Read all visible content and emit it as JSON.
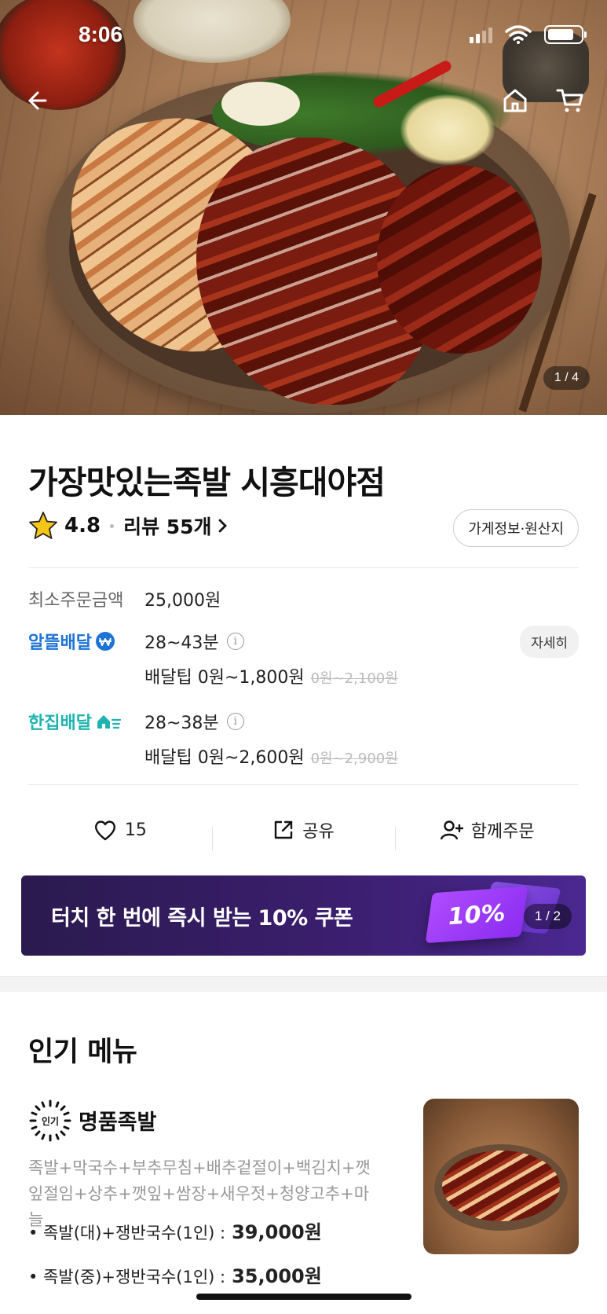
{
  "status_bar": {
    "time": "8:06"
  },
  "hero": {
    "photo_counter": "1 / 4"
  },
  "store": {
    "name": "가장맛있는족발 시흥대야점",
    "rating": "4.8",
    "review_label": "리뷰 55개",
    "info_button": "가게정보·원산지",
    "min_order_label": "최소주문금액",
    "min_order_value": "25,000원"
  },
  "delivery": [
    {
      "type": "알뜰배달",
      "color": "#1e73d6",
      "time": "28~43분",
      "tip": "배달팁 0원~1,800원",
      "original_tip": "0원~2,100원",
      "detail_button": "자세히"
    },
    {
      "type": "한집배달",
      "color": "#1fb3b0",
      "time": "28~38분",
      "tip": "배달팁 0원~2,600원",
      "original_tip": "0원~2,900원"
    }
  ],
  "actions": {
    "like_count": "15",
    "share_label": "공유",
    "group_order_label": "함께주문"
  },
  "coupon": {
    "text": "터치 한 번에 즉시 받는 10% 쿠폰",
    "ticket_label": "10%",
    "pager": "1 / 2"
  },
  "popular_menu": {
    "title": "인기 메뉴",
    "items": [
      {
        "badge": "인기",
        "name": "명품족발",
        "description": "족발+막국수+부추무침+배추겉절이+백김치+깻잎절임+상추+깻잎+쌈장+새우젓+청양고추+마늘",
        "options": [
          {
            "label": "• 족발(대)+쟁반국수(1인) :",
            "price": "39,000원"
          },
          {
            "label": "• 족발(중)+쟁반국수(1인) :",
            "price": "35,000원"
          }
        ]
      }
    ]
  },
  "icons": {
    "back": "arrow-left-icon",
    "home": "home-icon",
    "cart": "cart-icon",
    "star": "star-icon",
    "heart": "heart-icon",
    "share": "share-icon",
    "group": "add-user-icon"
  },
  "colors": {
    "coupon_bg": "#3b1e6e",
    "star": "#f5c518"
  }
}
